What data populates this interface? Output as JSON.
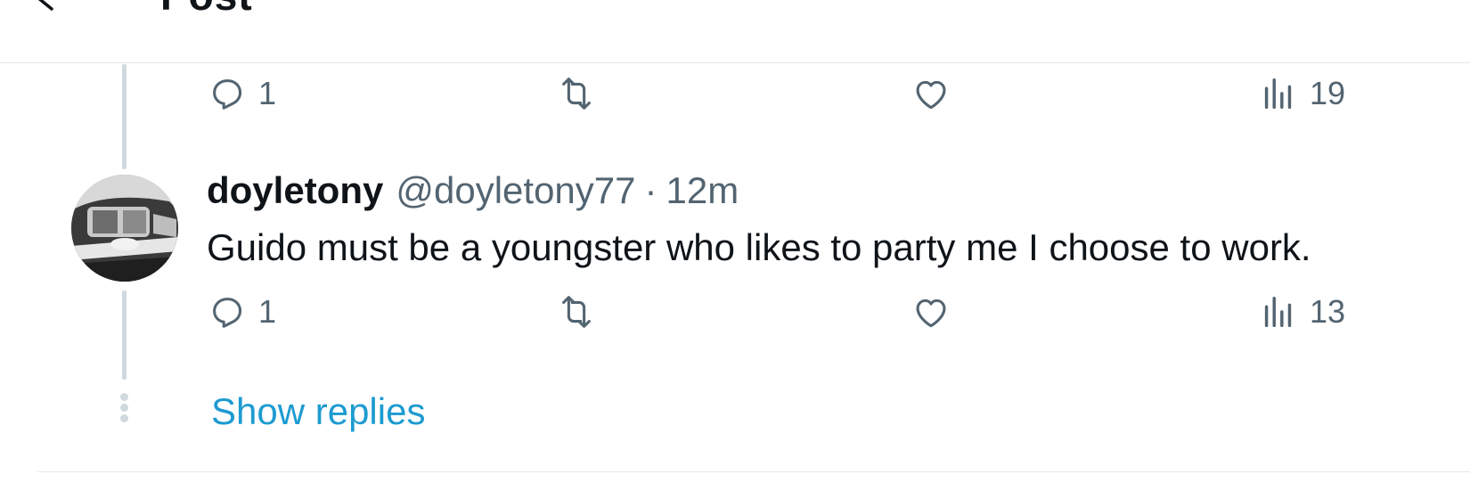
{
  "header": {
    "title": "Post",
    "back_icon": "arrow-left-icon"
  },
  "parent_post": {
    "actions": {
      "reply_count": "1",
      "repost_count": "",
      "like_count": "",
      "views_count": "19"
    }
  },
  "reply": {
    "display_name": "doyletony",
    "handle": "@doyletony77",
    "separator": "·",
    "time": "12m",
    "text": "Guido must be a youngster who likes to party me I choose to work.",
    "actions": {
      "reply_count": "1",
      "repost_count": "",
      "like_count": "",
      "views_count": "13"
    }
  },
  "show_replies_label": "Show replies",
  "colors": {
    "text_primary": "#0f1419",
    "text_secondary": "#536471",
    "link": "#1d9bd1",
    "thread_line": "#cfd9de",
    "border": "#e4e8eb"
  },
  "icons": [
    "arrow-left-icon",
    "reply-icon",
    "repost-icon",
    "like-icon",
    "views-icon"
  ]
}
